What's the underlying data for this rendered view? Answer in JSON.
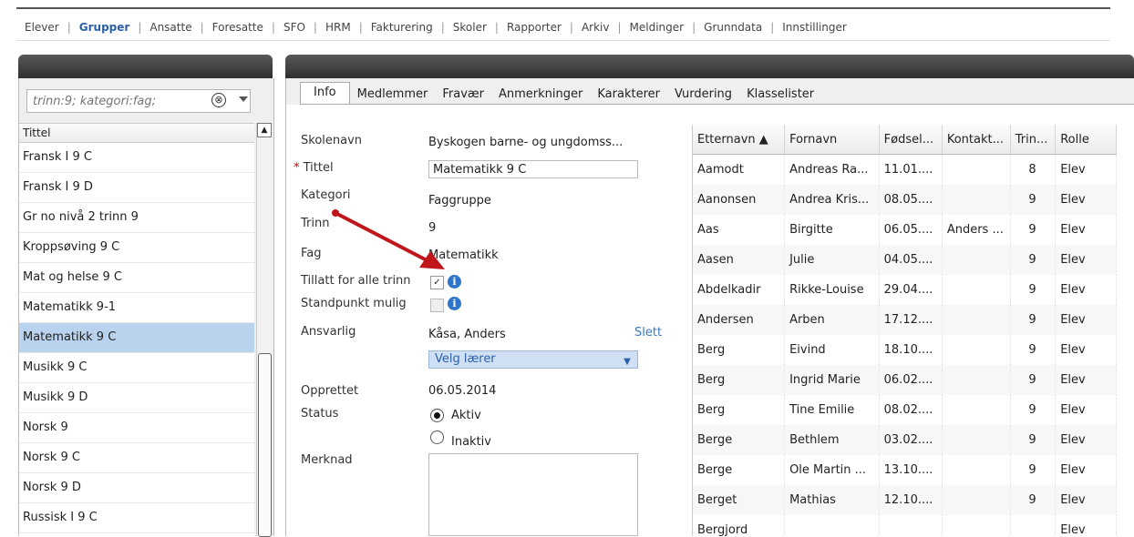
{
  "topnav": {
    "items": [
      "Elever",
      "Grupper",
      "Ansatte",
      "Foresatte",
      "SFO",
      "HRM",
      "Fakturering",
      "Skoler",
      "Rapporter",
      "Arkiv",
      "Meldinger",
      "Grunndata",
      "Innstillinger"
    ],
    "active": "Grupper"
  },
  "search": {
    "placeholder": "trinn:9; kategori:fag;",
    "clear_icon": "⊗"
  },
  "list": {
    "header": "Tittel",
    "items": [
      "Fransk I 9 C",
      "Fransk I 9 D",
      "Gr no nivå 2 trinn 9",
      "Kroppsøving 9 C",
      "Mat og helse 9 C",
      "Matematikk 9-1",
      "Matematikk 9 C",
      "Musikk 9 C",
      "Musikk 9 D",
      "Norsk 9",
      "Norsk 9 C",
      "Norsk 9 D",
      "Russisk I 9 C"
    ],
    "selected_index": 6
  },
  "tabs": [
    "Info",
    "Medlemmer",
    "Fravær",
    "Anmerkninger",
    "Karakterer",
    "Vurdering",
    "Klasselister"
  ],
  "form": {
    "skolenavn_label": "Skolenavn",
    "skolenavn_value": "Byskogen barne- og ungdomss...",
    "tittel_label": "Tittel",
    "tittel_value": "Matematikk 9 C",
    "kategori_label": "Kategori",
    "kategori_value": "Faggruppe",
    "trinn_label": "Trinn",
    "trinn_value": "9",
    "fag_label": "Fag",
    "fag_value": "Matematikk",
    "tillatt_label": "Tillatt for alle trinn",
    "standpunkt_label": "Standpunkt mulig",
    "ansvarlig_label": "Ansvarlig",
    "ansvarlig_value": "Kåsa, Anders",
    "slett_link": "Slett",
    "velg_placeholder": "Velg lærer",
    "opprettet_label": "Opprettet",
    "opprettet_value": "06.05.2014",
    "status_label": "Status",
    "status_aktiv": "Aktiv",
    "status_inaktiv": "Inaktiv",
    "merknad_label": "Merknad"
  },
  "grid": {
    "columns": [
      "Etternavn ▲",
      "Fornavn",
      "Fødsel...",
      "Kontakt...",
      "Trin...",
      "Rolle"
    ],
    "rows": [
      [
        "Aamodt",
        "Andreas Ra...",
        "11.01....",
        "",
        "8",
        "Elev"
      ],
      [
        "Aanonsen",
        "Andrea Kris...",
        "08.05....",
        "",
        "9",
        "Elev"
      ],
      [
        "Aas",
        "Birgitte",
        "06.05....",
        "Anders ...",
        "9",
        "Elev"
      ],
      [
        "Aasen",
        "Julie",
        "04.05....",
        "",
        "9",
        "Elev"
      ],
      [
        "Abdelkadir",
        "Rikke-Louise",
        "29.04....",
        "",
        "9",
        "Elev"
      ],
      [
        "Andersen",
        "Arben",
        "17.12....",
        "",
        "9",
        "Elev"
      ],
      [
        "Berg",
        "Eivind",
        "18.10....",
        "",
        "9",
        "Elev"
      ],
      [
        "Berg",
        "Ingrid Marie",
        "06.02....",
        "",
        "9",
        "Elev"
      ],
      [
        "Berg",
        "Tine Emilie",
        "08.02....",
        "",
        "9",
        "Elev"
      ],
      [
        "Berge",
        "Bethlem",
        "03.02....",
        "",
        "9",
        "Elev"
      ],
      [
        "Berge",
        "Ole Martin ...",
        "13.10....",
        "",
        "9",
        "Elev"
      ],
      [
        "Berget",
        "Mathias",
        "12.10....",
        "",
        "9",
        "Elev"
      ],
      [
        "Bergjord",
        "",
        "",
        "",
        "",
        "Elev"
      ]
    ]
  },
  "colors": {
    "accent": "#2a5fa8",
    "selected_row": "#b9d3ef",
    "arrow": "#c0161b"
  }
}
